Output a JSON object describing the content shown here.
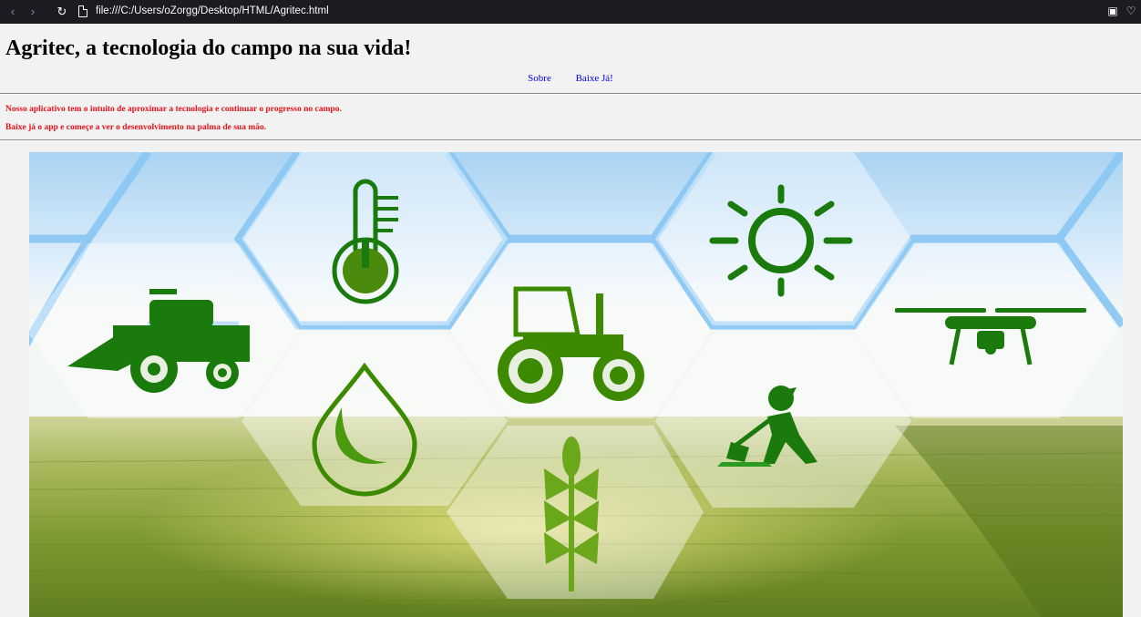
{
  "browser": {
    "url": "file:///C:/Users/oZorgg/Desktop/HTML/Agritec.html",
    "icons": [
      "back-icon",
      "forward-icon",
      "reload-icon",
      "page-icon",
      "screenshot-icon",
      "pocket-icon"
    ]
  },
  "page": {
    "title": "Agritec, a tecnologia do campo na sua vida!",
    "nav": [
      {
        "label": "Sobre"
      },
      {
        "label": "Baixe Já!"
      }
    ],
    "intro_line_1": "Nosso aplicativo tem o intuito de aproximar a tecnologia e continuar o progresso no campo.",
    "intro_line_2": "Baixe já o app e começe a ver o desenvolvimento na palma de sua mão."
  },
  "colors": {
    "intro_text": "#e8131a",
    "link": "#0000ee",
    "icon_green": "#1a7a0c",
    "sky": "#cfe6f7",
    "field": "#6f9428"
  },
  "hero": {
    "icons": [
      "harvester-icon",
      "thermometer-icon",
      "tractor-icon",
      "sun-icon",
      "drone-icon",
      "water-drop-icon",
      "wheat-icon",
      "farmer-digging-icon"
    ]
  }
}
